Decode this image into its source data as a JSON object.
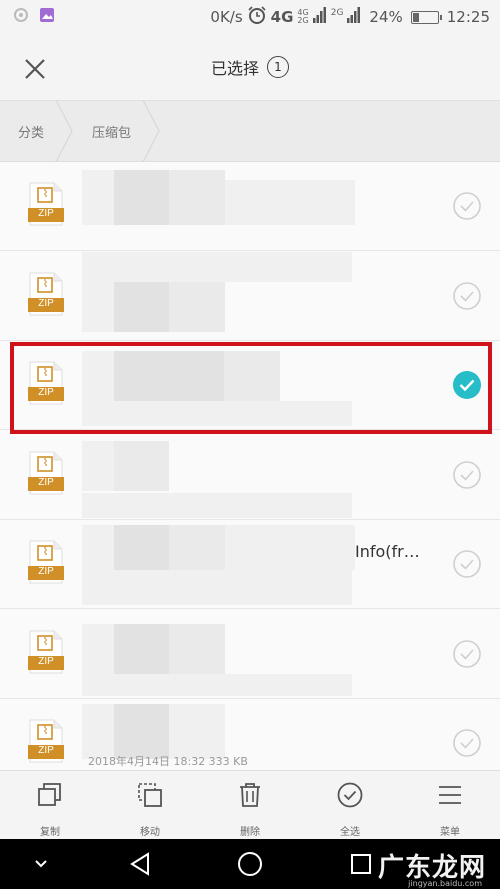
{
  "status_bar": {
    "net_speed": "0K/s",
    "network_4g": "4G",
    "network_small_top": "4G",
    "network_small_bottom": "2G",
    "network_2g": "2G",
    "battery_percent": "24%",
    "battery_level": 0.24,
    "time": "12:25"
  },
  "header": {
    "title": "已选择",
    "selected_count": "1"
  },
  "breadcrumb": {
    "items": [
      "分类",
      "压缩包"
    ]
  },
  "files": [
    {
      "type_label": "ZIP",
      "info_text": "",
      "meta": "",
      "checked": false
    },
    {
      "type_label": "ZIP",
      "info_text": "",
      "meta": "",
      "checked": false
    },
    {
      "type_label": "ZIP",
      "info_text": "",
      "meta": "",
      "checked": true
    },
    {
      "type_label": "ZIP",
      "info_text": "",
      "meta": "",
      "checked": false
    },
    {
      "type_label": "ZIP",
      "info_text": "Info(fr…",
      "meta": "",
      "checked": false
    },
    {
      "type_label": "ZIP",
      "info_text": "",
      "meta": "",
      "checked": false
    },
    {
      "type_label": "ZIP",
      "info_text": "",
      "meta": "2018年4月14日  18:32  333 KB",
      "checked": false
    }
  ],
  "toolbar": {
    "copy": "复制",
    "move": "移动",
    "delete": "删除",
    "select_all": "全选",
    "menu": "菜单"
  },
  "watermark": {
    "title": "广东龙网",
    "site": "jingyan.baidu.com"
  },
  "colors": {
    "accent": "#26bcc8",
    "zip_orange": "#d18f27",
    "highlight_red": "#d0121b"
  }
}
